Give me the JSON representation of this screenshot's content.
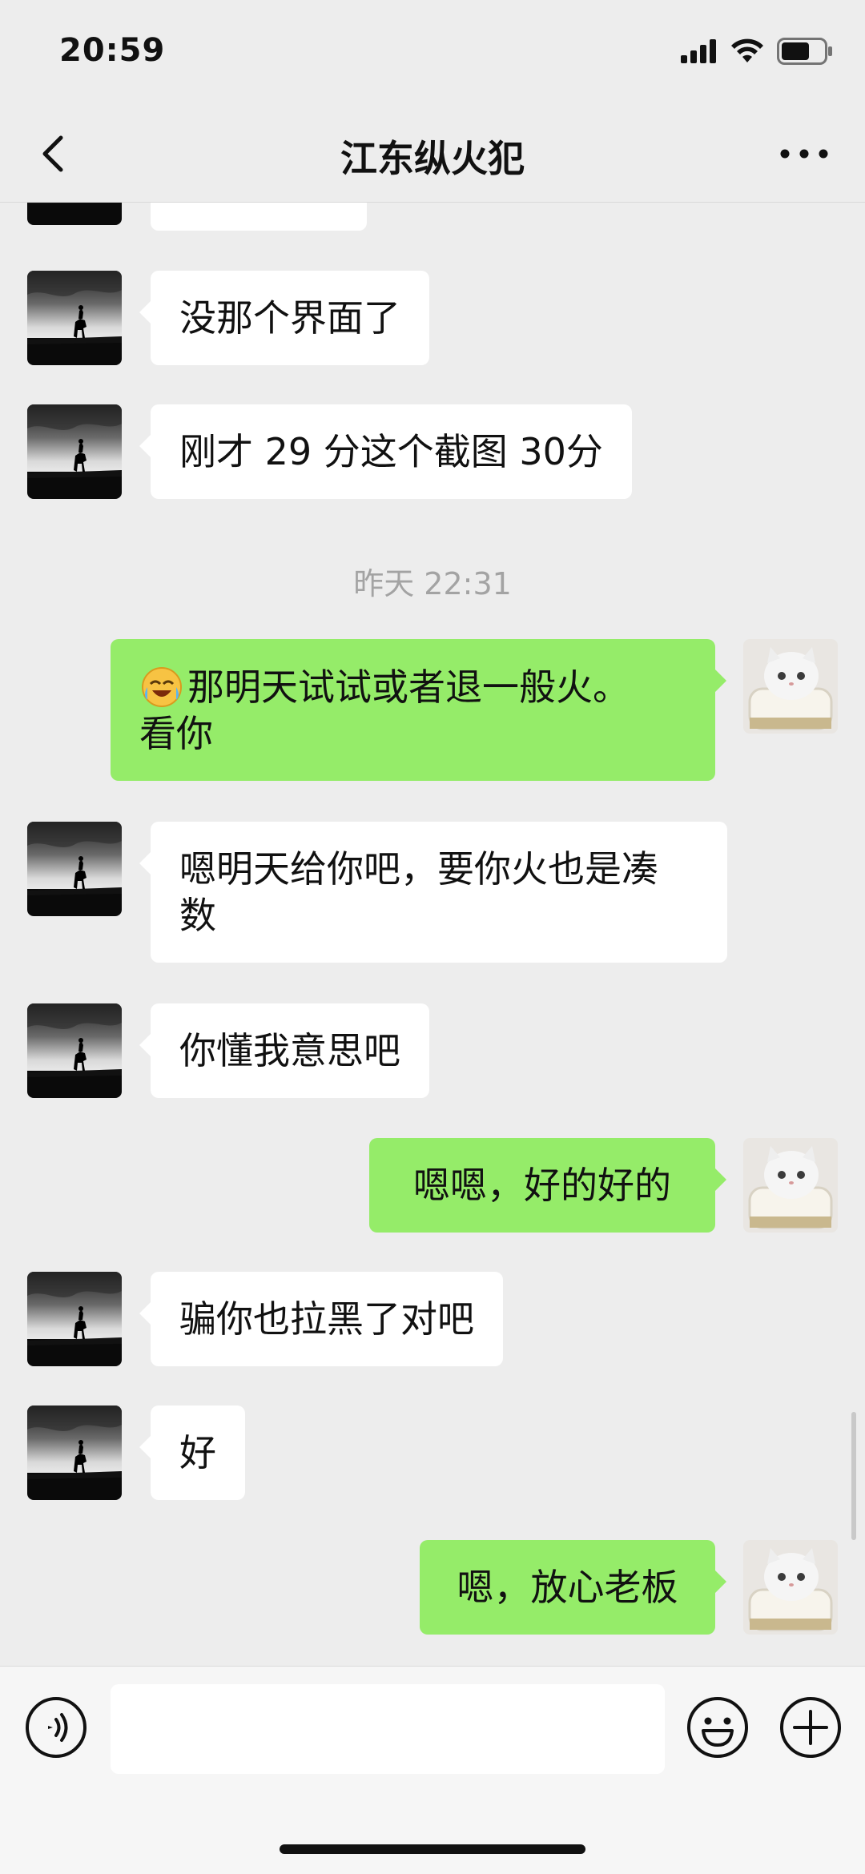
{
  "status_bar": {
    "time": "20:59"
  },
  "header": {
    "title": "江东纵火犯"
  },
  "messages": [
    {
      "side": "left",
      "text": ""
    },
    {
      "side": "left",
      "text": "没那个界面了"
    },
    {
      "side": "left",
      "text": "刚才 29 分这个截图 30分"
    },
    {
      "timestamp": "昨天 22:31"
    },
    {
      "side": "right",
      "emoji": "crying-laughing-emoji",
      "line1": "那明天试试或者退一般火。",
      "line2": "看你"
    },
    {
      "side": "left",
      "line1": "嗯明天给你吧，要你火也是凑",
      "line2": "数"
    },
    {
      "side": "left",
      "text": "你懂我意思吧"
    },
    {
      "side": "right",
      "text": "嗯嗯，好的好的"
    },
    {
      "side": "left",
      "text": "骗你也拉黑了对吧"
    },
    {
      "side": "left",
      "text": "好"
    },
    {
      "side": "right",
      "text": "嗯，放心老板"
    }
  ],
  "input_bar": {
    "text_value": ""
  },
  "colors": {
    "background": "#ededed",
    "bubble_self": "#95ec69",
    "bubble_other": "#ffffff",
    "timestamp": "#a3a3a3"
  }
}
